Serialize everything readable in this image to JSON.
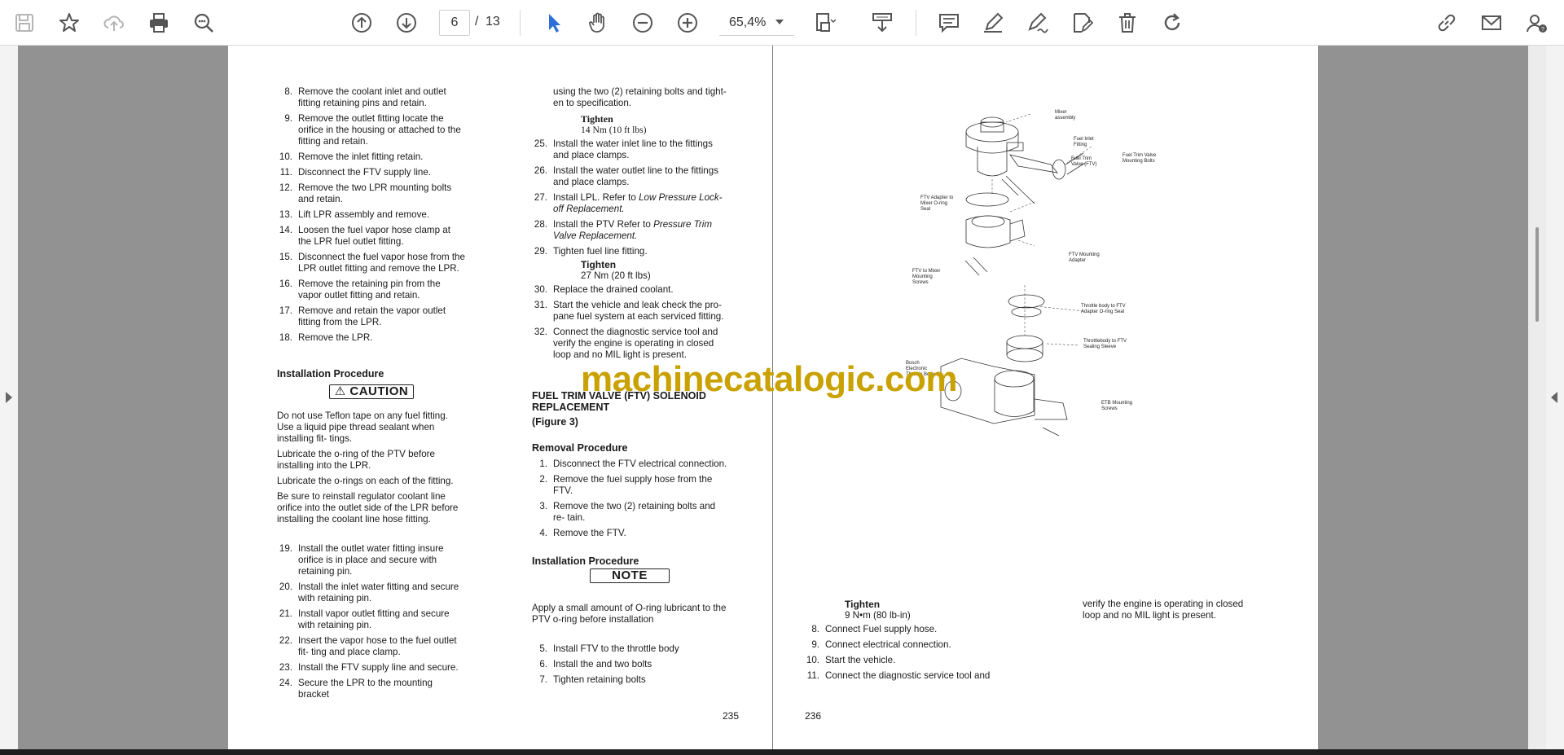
{
  "toolbar": {
    "page_current": "6",
    "page_separator": "/",
    "page_total": "13",
    "zoom": "65,4%",
    "icons": [
      "save-icon",
      "bookmark-star-icon",
      "cloud-upload-icon",
      "print-icon",
      "zoom-search-icon",
      "page-up-icon",
      "page-down-icon",
      "select-cursor-icon",
      "hand-icon",
      "zoom-out-icon",
      "zoom-in-icon",
      "page-fit-icon",
      "download-icon",
      "comment-icon",
      "pen-icon",
      "sign-icon",
      "edit-icon",
      "delete-icon",
      "rotate-icon",
      "link-icon",
      "mail-icon",
      "account-icon"
    ]
  },
  "watermark": "machinecatalogic.com",
  "left_page": {
    "col1_items_a": [
      {
        "num": "8.",
        "text": "Remove the coolant inlet and outlet fitting retaining pins and retain."
      },
      {
        "num": "9.",
        "text": "Remove the outlet fitting locate the orifice in the housing or attached to the fitting and retain."
      },
      {
        "num": "10.",
        "text": "Remove the inlet fitting retain."
      },
      {
        "num": "11.",
        "text": "Disconnect the FTV supply line."
      },
      {
        "num": "12.",
        "text": "Remove the two LPR mounting bolts and retain."
      },
      {
        "num": "13.",
        "text": "Lift LPR assembly and remove."
      },
      {
        "num": "14.",
        "text": "Loosen the fuel vapor hose clamp at the LPR fuel outlet fitting."
      },
      {
        "num": "15.",
        "text": "Disconnect the fuel vapor hose from the LPR outlet fitting and remove the LPR."
      },
      {
        "num": "16.",
        "text": "Remove the retaining pin from the vapor outlet fitting and retain."
      },
      {
        "num": "17.",
        "text": "Remove and retain the vapor outlet fitting from the LPR."
      },
      {
        "num": "18.",
        "text": "Remove the LPR."
      }
    ],
    "install_heading": "Installation Procedure",
    "caution_label": "CAUTION",
    "caution_paras": [
      "Do not use Teflon tape on any fuel fitting. Use a liquid pipe thread sealant when installing fit- tings.",
      "Lubricate the o-ring of the PTV before installing into the LPR.",
      "Lubricate the o-rings on each of the fitting.",
      "Be sure to reinstall regulator coolant line orifice into the outlet side of the LPR before installing the coolant line hose fitting."
    ],
    "col1_items_b": [
      {
        "num": "19.",
        "text": "Install the outlet water fitting insure orifice is in place and secure with retaining pin."
      },
      {
        "num": "20.",
        "text": "Install the inlet water fitting and secure with retaining pin."
      },
      {
        "num": "21.",
        "text": "Install vapor outlet fitting and secure with retaining pin."
      },
      {
        "num": "22.",
        "text": "Insert the vapor hose to the fuel outlet fit- ting and place clamp."
      },
      {
        "num": "23.",
        "text": "Install the FTV supply line and secure."
      },
      {
        "num": "24.",
        "text": "Secure the LPR to the mounting bracket"
      }
    ],
    "col2_cont": "using the two (2) retaining bolts and tight- en to specification.",
    "tighten1_head": "Tighten",
    "tighten1_val": "14 Nm (10 ft lbs)",
    "col2_items_a": [
      {
        "num": "25.",
        "text": "Install the water inlet line to the fittings and place clamps."
      },
      {
        "num": "26.",
        "text": "Install the water outlet line to the fittings and place clamps."
      }
    ],
    "item27_num": "27.",
    "item27_text": "Install LPL. Refer to",
    "item27_ref": "Low Pressure Lock-off Replacement.",
    "item28_num": "28.",
    "item28_text": "Install the PTV Refer to",
    "item28_ref": "Pressure Trim Valve Replacement.",
    "item29_num": "29.",
    "item29_text": "Tighten fuel line fitting.",
    "tighten2_head": "Tighten",
    "tighten2_val": "27 Nm (20 ft lbs)",
    "col2_items_b": [
      {
        "num": "30.",
        "text": "Replace the drained coolant."
      },
      {
        "num": "31.",
        "text": "Start the vehicle and leak check the pro- pane fuel system at each serviced fitting."
      },
      {
        "num": "32.",
        "text": "Connect  the diagnostic service tool and verify the engine is operating in closed loop and no MIL  light is present."
      }
    ],
    "ftv_heading_1": "FUEL TRIM VALVE (FTV) SOLENOID",
    "ftv_heading_2": "REPLACEMENT",
    "ftv_figure": "(Figure 3)",
    "removal_heading": "Removal Procedure",
    "removal_items": [
      {
        "num": "1.",
        "text": "Disconnect the FTV electrical connection."
      },
      {
        "num": "2.",
        "text": "Remove the fuel supply hose from the FTV."
      },
      {
        "num": "3.",
        "text": "Remove the two (2) retaining bolts and re- tain."
      },
      {
        "num": "4.",
        "text": "Remove the FTV."
      }
    ],
    "install2_heading": "Installation Procedure",
    "note_label": "NOTE",
    "note_para": "Apply a small amount of O-ring lubricant to the PTV o-ring before installation",
    "install2_items": [
      {
        "num": "5.",
        "text": "Install FTV to the throttle body"
      },
      {
        "num": "6.",
        "text": "Install the and two bolts"
      },
      {
        "num": "7.",
        "text": "Tighten retaining bolts"
      }
    ],
    "page_number": "235"
  },
  "right_page": {
    "tighten_head": "Tighten",
    "tighten_val": "9 N•m (80 lb-in)",
    "items": [
      {
        "num": "8.",
        "text": "Connect Fuel supply hose."
      },
      {
        "num": "9.",
        "text": "Connect electrical connection."
      },
      {
        "num": "10.",
        "text": "Start the vehicle."
      },
      {
        "num": "11.",
        "text": "Connect  the diagnostic service tool and"
      }
    ],
    "cont_text": "verify the engine is operating in closed loop and no MIL  light is present.",
    "page_number": "236",
    "diagram_labels": {
      "mixer": "Mixer assembly",
      "fuel_inlet": "Fuel Inlet Fitting",
      "fuel_trim": "Fuel Trim Valve (FTV)",
      "ftv_bolts": "Fuel Trim Valve Mounting Bolts",
      "ptv_adapter": "FTV Adapter to Mixer O-ring Seal",
      "ftv_mount": "FTV Mounting Adapter",
      "ftv_screws": "FTV to Mixer Mounting Screws",
      "throttle_oring": "Throttle body to FTV Adapter O-ring Seal",
      "throttle_sleeve": "Throttlebody to FTV Sealing Sleeve",
      "etb": "Bosch Electronic Throttle Body",
      "etb_screws": "ETB Mounting Screws"
    }
  }
}
